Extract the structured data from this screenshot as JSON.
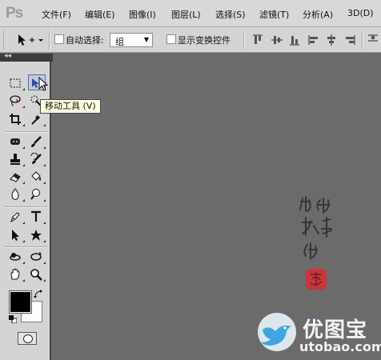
{
  "app": {
    "logo": "Ps"
  },
  "menu": [
    {
      "label": "文件(F)"
    },
    {
      "label": "编辑(E)"
    },
    {
      "label": "图像(I)"
    },
    {
      "label": "图层(L)"
    },
    {
      "label": "选择(S)"
    },
    {
      "label": "滤镜(T)"
    },
    {
      "label": "分析(A)"
    },
    {
      "label": "3D(D)"
    }
  ],
  "options_bar": {
    "auto_select_label": "自动选择:",
    "auto_select_checked": false,
    "auto_select_value": "组",
    "show_transform_label": "显示变换控件",
    "show_transform_checked": false
  },
  "tooltip": {
    "text": "移动工具 (V)"
  },
  "colors": {
    "foreground": "#000000",
    "background": "#ffffff",
    "canvas": "#6b6b6b",
    "panel": "#d4d4d4"
  },
  "tools": [
    "rectangular-marquee",
    "move",
    "lasso",
    "quick-selection",
    "crop",
    "eyedropper",
    "spot-healing-brush",
    "brush",
    "clone-stamp",
    "history-brush",
    "eraser",
    "paint-bucket",
    "blur",
    "dodge",
    "pen",
    "horizontal-type",
    "path-selection",
    "custom-shape",
    "3d-rotate",
    "3d-orbit",
    "hand",
    "zoom"
  ],
  "watermark": {
    "name": "优图宝",
    "url": "utobao.com"
  }
}
